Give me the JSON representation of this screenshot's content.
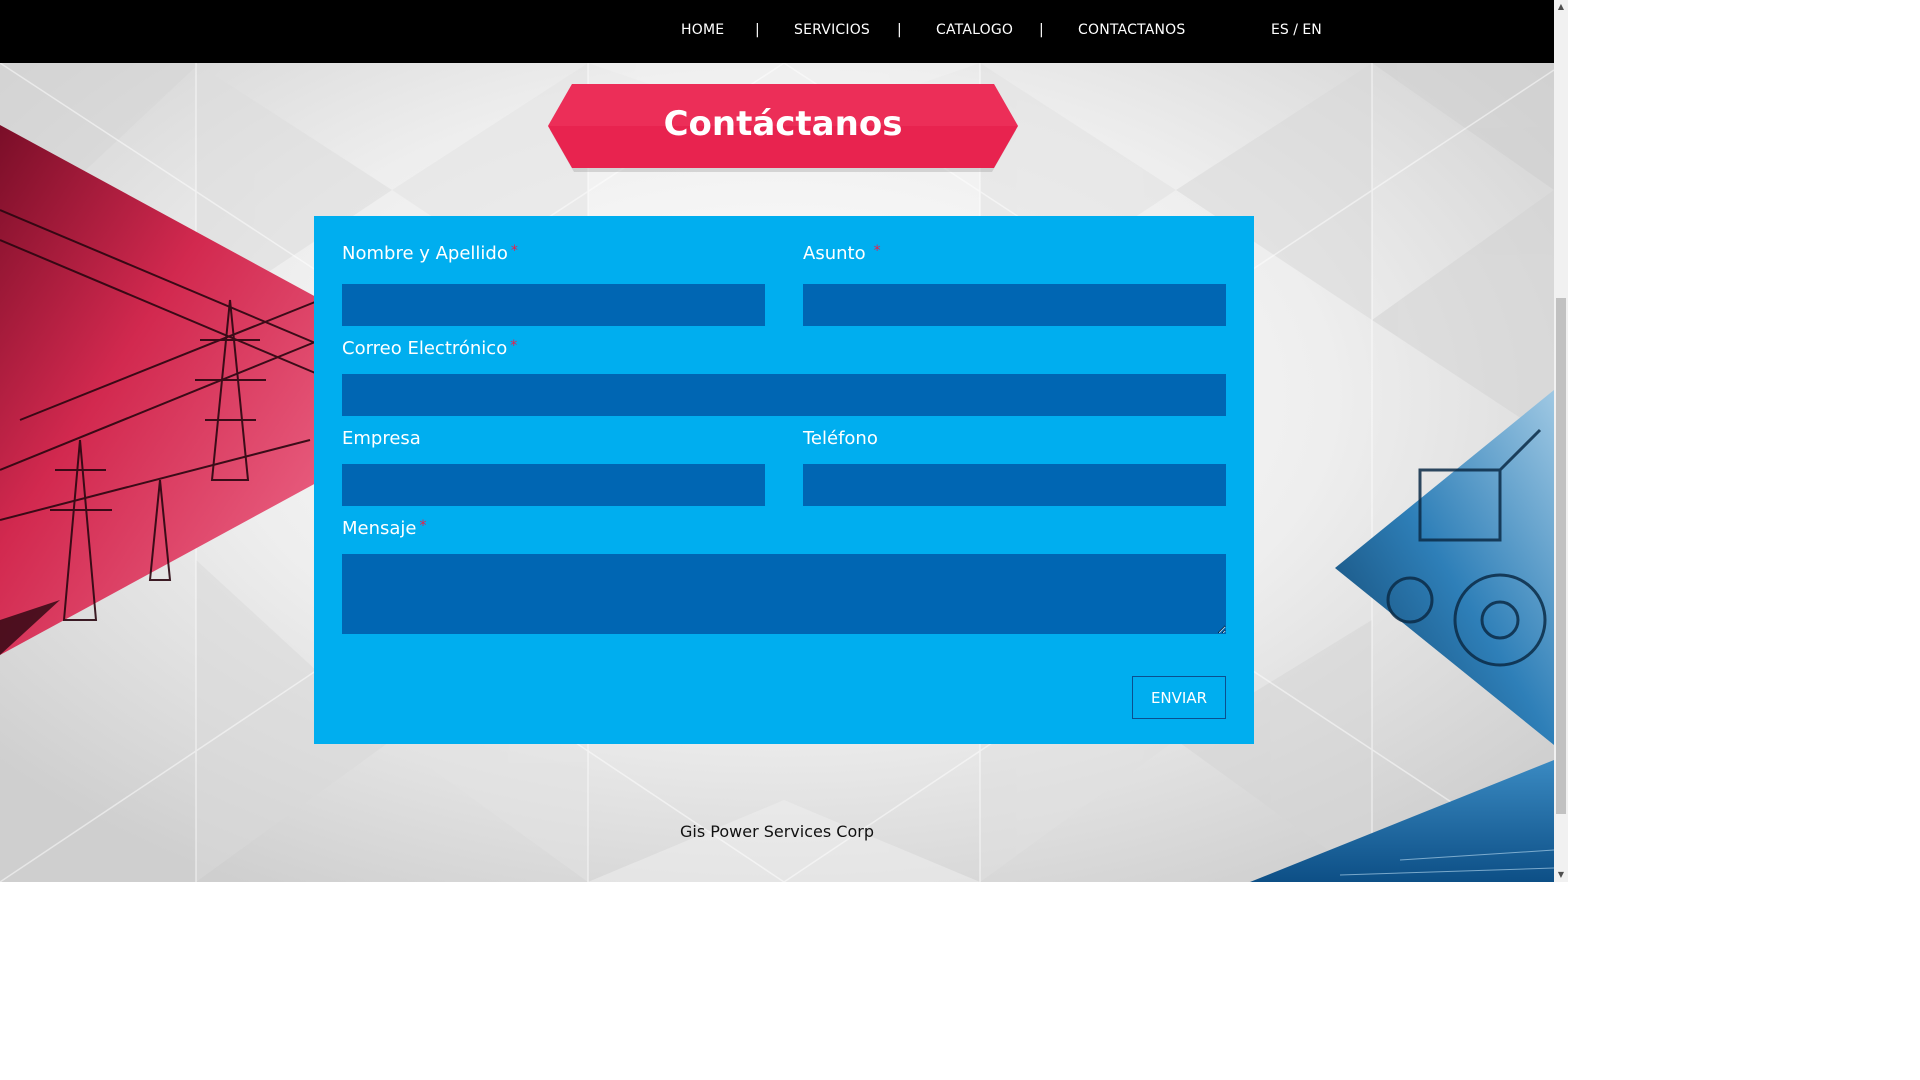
{
  "nav": {
    "items": [
      {
        "label": "HOME"
      },
      {
        "label": "SERVICIOS"
      },
      {
        "label": "CATALOGO"
      },
      {
        "label": "CONTACTANOS"
      }
    ],
    "separator": "|",
    "lang": {
      "es": "ES",
      "divider": "/",
      "en": "EN"
    }
  },
  "section": {
    "title": "Contáctanos"
  },
  "form": {
    "name_label": "Nombre y Apellido",
    "subject_label": "Asunto",
    "email_label": "Correo Electrónico",
    "company_label": "Empresa",
    "phone_label": "Teléfono",
    "message_label": "Mensaje",
    "required_mark": "*",
    "submit_label": "ENVIAR",
    "name_value": "",
    "subject_value": "",
    "email_value": "",
    "company_value": "",
    "phone_value": "",
    "message_value": ""
  },
  "footer": {
    "company": "Gis Power Services Corp"
  },
  "colors": {
    "nav_bg": "#000000",
    "ribbon": "#e8234f",
    "panel": "#00aeef",
    "field": "#0066b3",
    "required": "#ed1c45"
  },
  "icons": {
    "scroll_up": "scroll-up-arrow-icon",
    "scroll_down": "scroll-down-arrow-icon"
  }
}
